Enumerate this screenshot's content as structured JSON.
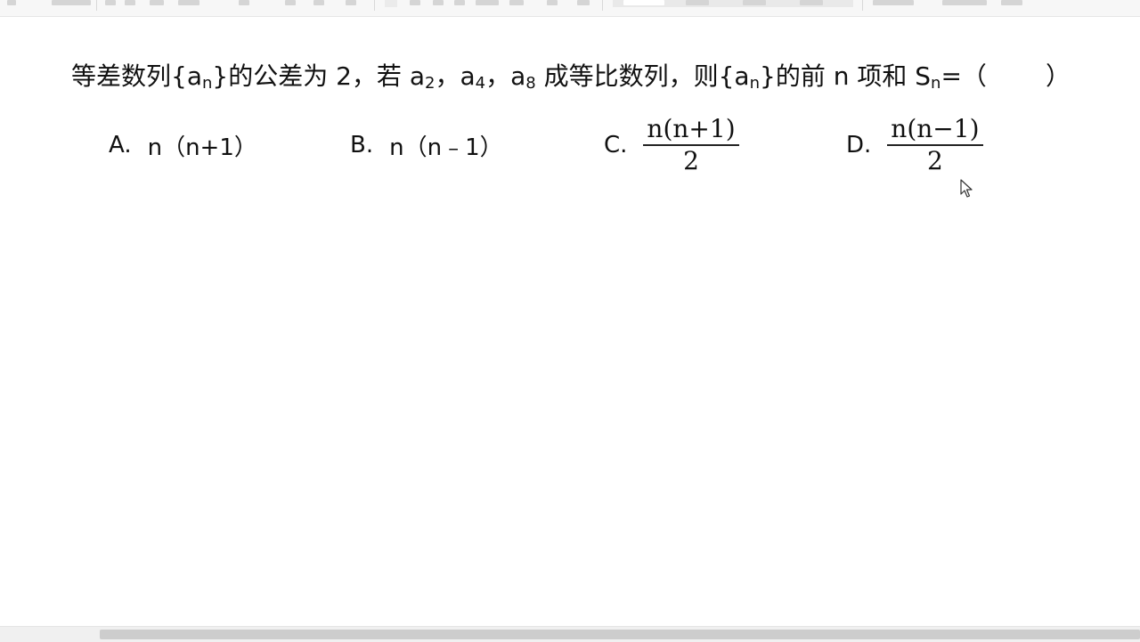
{
  "question": {
    "part1": "等差数列{a",
    "sub_n1": "n",
    "part2": "}的公差为 2，若 a",
    "sub_2": "2",
    "part3": "，a",
    "sub_4": "4",
    "part4": "，a",
    "sub_8": "8",
    "part5": " 成等比数列，则{a",
    "sub_n2": "n",
    "part6": "}的前 n 项和 S",
    "sub_n3": "n",
    "part7": "=（",
    "part8": "）"
  },
  "options": [
    {
      "letter": "A.",
      "text": "n（n+1）"
    },
    {
      "letter": "B.",
      "text": "n（n﹣1）"
    },
    {
      "letter": "C.",
      "numerator": "n(n+1)",
      "denominator": "2"
    },
    {
      "letter": "D.",
      "numerator": "n(n−1)",
      "denominator": "2"
    }
  ]
}
